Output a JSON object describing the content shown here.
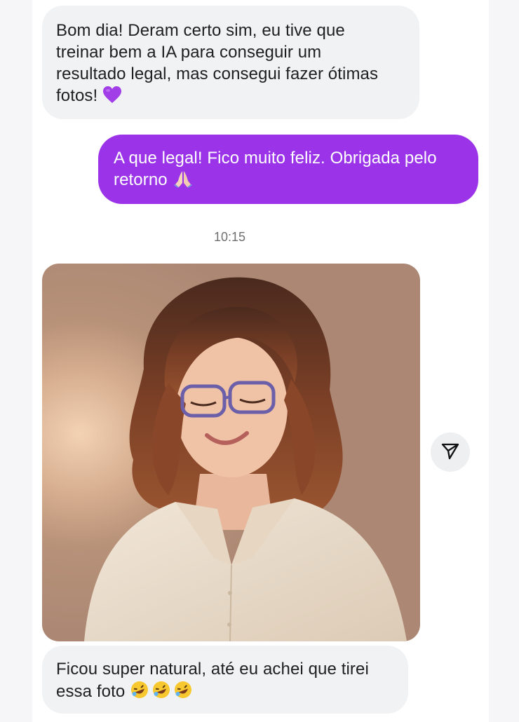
{
  "messages": [
    {
      "direction": "incoming",
      "text": "Bom dia! Deram certo sim, eu tive que treinar bem a IA para conseguir um resultado legal, mas consegui fazer ótimas fotos!",
      "lines": [
        "Bom dia! Deram certo sim, eu tive que",
        "treinar bem a IA para conseguir um",
        "resultado legal, mas consegui fazer ótimas",
        "fotos!"
      ],
      "emoji": "purple-heart"
    },
    {
      "direction": "outgoing",
      "text": "A que legal! Fico muito feliz. Obrigada pelo retorno",
      "lines": [
        "A que legal! Fico muito feliz. Obrigada pelo",
        "retorno"
      ],
      "emoji": "folded-hands"
    },
    {
      "direction": "incoming",
      "type": "image",
      "image_description": "portrait of smiling woman with wavy auburn hair, purple glasses and cream shirt"
    },
    {
      "direction": "incoming",
      "text": "Ficou super natural, até eu achei que tirei essa foto",
      "lines": [
        "Ficou super natural, até eu achei que tirei",
        "essa foto"
      ],
      "emoji": "rolling-on-floor-laughing x3"
    }
  ],
  "timestamp": "10:15",
  "icons": {
    "share": "paper-plane-icon"
  },
  "colors": {
    "outgoing_bubble": "#9b34e8",
    "incoming_bubble": "#f1f2f4",
    "timestamp": "#6f6f72"
  }
}
